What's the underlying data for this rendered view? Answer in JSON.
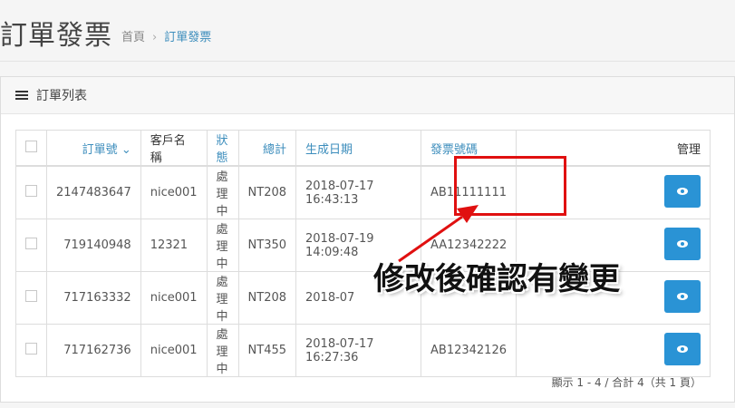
{
  "header": {
    "title": "訂單發票",
    "breadcrumb": {
      "home": "首頁",
      "separator": "›",
      "current": "訂單發票"
    }
  },
  "panel": {
    "title": "訂單列表"
  },
  "table": {
    "columns": [
      "訂單號",
      "客戶名稱",
      "狀態",
      "總計",
      "生成日期",
      "發票號碼",
      "管理"
    ],
    "rows": [
      [
        "2147483647",
        "nice001",
        "處理中",
        "NT208",
        "2018-07-17 16:43:13",
        "AB11111111"
      ],
      [
        "719140948",
        "12321",
        "處理中",
        "NT350",
        "2018-07-19 14:09:48",
        "AA12342222"
      ],
      [
        "717163332",
        "nice001",
        "處理中",
        "NT208",
        "2018-07",
        ""
      ],
      [
        "717162736",
        "nice001",
        "處理中",
        "NT455",
        "2018-07-17 16:27:36",
        "AB12342126"
      ]
    ]
  },
  "pagination": {
    "summary": "顯示 1 - 4 / 合計 4（共 1 頁）"
  },
  "annotation": {
    "text": "修改後確認有變更",
    "color": "#e01010"
  },
  "icons": {
    "list": "list-icon",
    "eye": "eye-icon",
    "sort": "chevron-down-icon"
  }
}
